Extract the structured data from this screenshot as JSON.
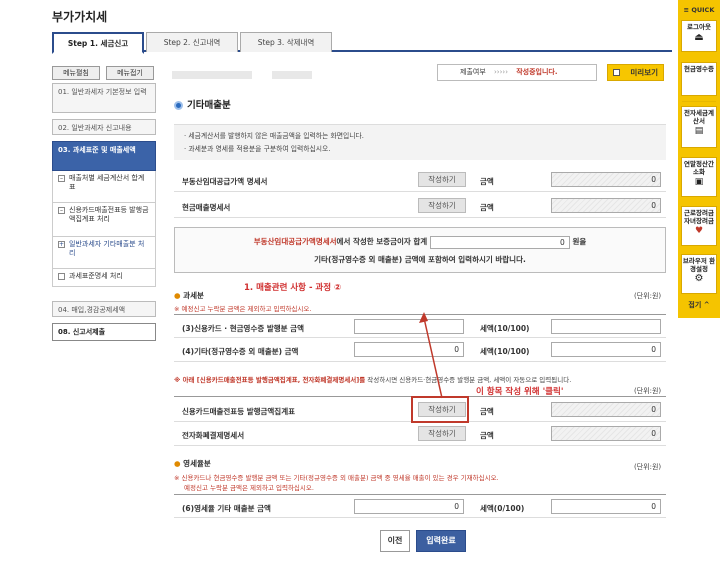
{
  "page": {
    "title": "부가가치세"
  },
  "tabs": [
    {
      "label": "Step 1. 세금신고"
    },
    {
      "label": "Step 2. 신고내역"
    },
    {
      "label": "Step 3. 삭제내역"
    }
  ],
  "sidebar": {
    "expand_label": "메뉴펼침",
    "collapse_label": "메뉴접기",
    "items": [
      {
        "label": "01. 일반과세자 기본정보 입력"
      },
      {
        "label": "02. 일반과세자 신고내용"
      },
      {
        "label": "03. 과세표준 및 매출세액"
      },
      {
        "label": "04. 매입,경감공제세액"
      },
      {
        "label": "08. 신고서제출"
      }
    ],
    "subitems": [
      {
        "label": "매출처별 세금계산서 합계표",
        "bullet": "–"
      },
      {
        "label": "신용카드매출전표등 발행금액집계표 처리",
        "bullet": "–"
      },
      {
        "label": "일반과세자 기타매출분 처리",
        "bullet": "+"
      },
      {
        "label": "과세표준명세 처리",
        "bullet": ""
      }
    ]
  },
  "status": {
    "label": "제출여부",
    "arrows": "›››››",
    "value": "작성중입니다.",
    "preview_label": "미리보기"
  },
  "section": {
    "title": "기타매출분",
    "info": [
      "· 세금계산서를 발행하지 않은 매출금액을 입력하는 화면입니다.",
      "· 과세분과 영세를 적용분을 구분하여 입력하십시오."
    ]
  },
  "rental_rows": [
    {
      "label": "부동산임대공급가액 명세서",
      "button": "작성하기",
      "amount_label": "금액",
      "amount": "0"
    },
    {
      "label": "현금매출명세서",
      "button": "작성하기",
      "amount_label": "금액",
      "amount": "0"
    }
  ],
  "notice": {
    "part1_red": "부동산임대공급가액명세서",
    "part1_rest": "에서 작성한 보증금이자 합계",
    "deposit_value": "0",
    "unit": "원을",
    "line2": "기타(정규영수증 외 매출분) 금액에 포함하여 입력하시기 바랍니다."
  },
  "taxable": {
    "header": "과세분",
    "unit": "(단위:원)",
    "note": "※ 예정신고 누락분 금액은 제외하고 입력하십시오.",
    "rows": [
      {
        "label": "(3)신용카드 · 현금영수증 발행분 금액",
        "value": "",
        "tax_label": "세액(10/100)",
        "tax": ""
      },
      {
        "label": "(4)기타(정규영수증 외 매출분) 금액",
        "value": "0",
        "tax_label": "세액(10/100)",
        "tax": "0"
      }
    ]
  },
  "card_note": {
    "text_bold": "※ 아래 [신용카드매출전표등 발행금액집계표, 전자화폐결제명세서]를",
    "text_rest": " 작성하시면 신용카드·현금영수증 발행분 금액, 세액이 자동으로 입력됩니다.",
    "unit": "(단위:원)"
  },
  "card_rows": [
    {
      "label": "신용카드매출전표등 발행금액집계표",
      "button": "작성하기",
      "amount_label": "금액",
      "amount": "0"
    },
    {
      "label": "전자화폐결제명세서",
      "button": "작성하기",
      "amount_label": "금액",
      "amount": "0"
    }
  ],
  "zero_rate": {
    "header": "영세율분",
    "unit": "(단위:원)",
    "note1": "※ 신용카드나 현금영수증 발행분 금액 또는 기타(정규영수증 외 매출분) 금액 중 영세율 매출이 있는 경우 기재하십시오.",
    "note2": "예정신고 누락분 금액은 제외하고 입력하십시오.",
    "row": {
      "label": "(6)영세율 기타 매출분 금액",
      "value": "0",
      "tax_label": "세액(0/100)",
      "tax": "0"
    }
  },
  "buttons": {
    "prev": "이전",
    "done": "입력완료"
  },
  "annotations": {
    "step": "1. 매출관련 사항 - 과정 ②",
    "click": "이 항목 작성 위해 '클릭'",
    "color": "#d03030"
  },
  "quick": {
    "header": "≡ QUICK",
    "items": [
      {
        "label": "로그아웃",
        "icon": "logout-icon"
      },
      {
        "label": "현금영수증",
        "icon": "receipt-icon"
      },
      {
        "label": "전자세금계산서",
        "icon": "invoice-icon"
      },
      {
        "label": "연말정산간소화",
        "icon": "yearend-icon"
      },
      {
        "label": "근로장려금자녀장려금",
        "icon": "heart-icon"
      },
      {
        "label": "브라우저 환경설정",
        "icon": "gear-icon"
      },
      {
        "label": "접기 ^",
        "icon": ""
      }
    ]
  }
}
